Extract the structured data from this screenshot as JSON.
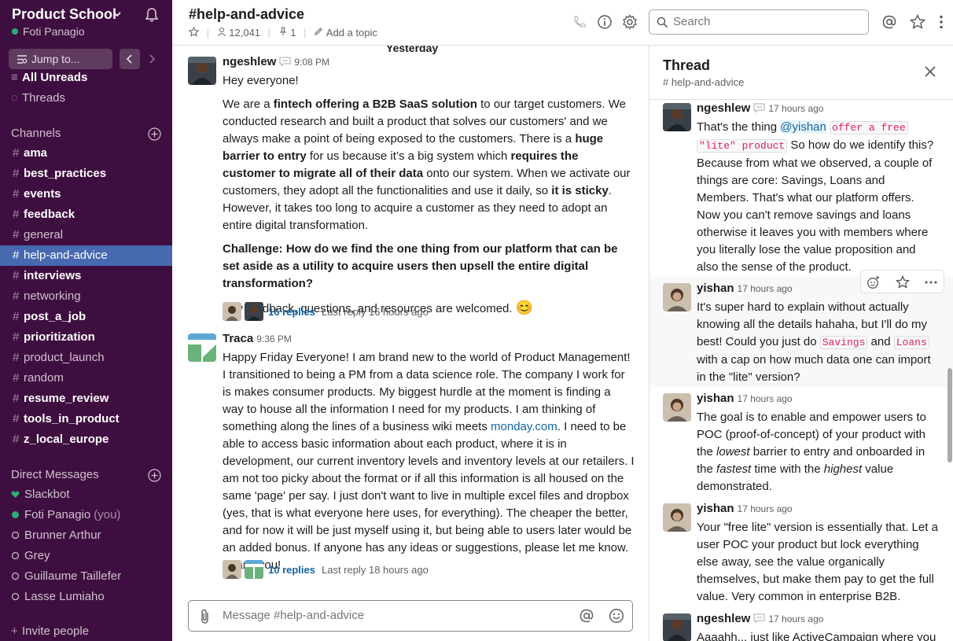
{
  "workspace": {
    "name": "Product School",
    "user": "Foti Panagio"
  },
  "sidebar": {
    "jump_label": "Jump to...",
    "top_items": [
      {
        "label": "All Unreads"
      },
      {
        "label": "Threads"
      }
    ],
    "channels_heading": "Channels",
    "channels": [
      {
        "name": "ama",
        "bold": true
      },
      {
        "name": "best_practices",
        "bold": true
      },
      {
        "name": "events",
        "bold": true
      },
      {
        "name": "feedback",
        "bold": true
      },
      {
        "name": "general",
        "bold": false
      },
      {
        "name": "help-and-advice",
        "bold": false,
        "active": true
      },
      {
        "name": "interviews",
        "bold": true
      },
      {
        "name": "networking",
        "bold": false
      },
      {
        "name": "post_a_job",
        "bold": true
      },
      {
        "name": "prioritization",
        "bold": true
      },
      {
        "name": "product_launch",
        "bold": false
      },
      {
        "name": "random",
        "bold": false
      },
      {
        "name": "resume_review",
        "bold": true
      },
      {
        "name": "tools_in_product",
        "bold": true
      },
      {
        "name": "z_local_europe",
        "bold": true
      }
    ],
    "dm_heading": "Direct Messages",
    "dms": [
      {
        "name": "Slackbot",
        "status": "heart"
      },
      {
        "name": "Foti Panagio",
        "status": "online",
        "suffix": "(you)"
      },
      {
        "name": "Brunner Arthur",
        "status": "away"
      },
      {
        "name": "Grey",
        "status": "away"
      },
      {
        "name": "Guillaume Taillefer",
        "status": "away"
      },
      {
        "name": "Lasse Lumiaho",
        "status": "away"
      }
    ],
    "invite_label": "Invite people"
  },
  "channel": {
    "name": "#help-and-advice",
    "members": "12,041",
    "pins": "1",
    "add_topic": "Add a topic",
    "day_divider": "Yesterday"
  },
  "search": {
    "placeholder": "Search"
  },
  "messages": [
    {
      "author": "ngeshlew",
      "time": "9:08 PM",
      "greeting": "Hey everyone!",
      "p1": [
        "We are a ",
        "fintech offering a B2B SaaS solution",
        " to our target customers. We conducted research and built a product that solves our customers' and we always make a point of being exposed to the customers. There is a ",
        "huge barrier to entry",
        " for us because it’s a big system which ",
        "requires the customer to migrate all of their data",
        " onto our system. When we activate our customers, they adopt all the functionalities and use it daily, so ",
        "it is sticky",
        ". However, it takes too long to acquire a customer as they need to adopt an entire digital transformation."
      ],
      "challenge": "Challenge: How do we find the one thing from our platform that can be set aside as a utility to acquire users then upsell the entire digital transformation?",
      "closing": "Any feedback, questions, and resources are welcomed.",
      "emoji": "😊",
      "replies": "16 replies",
      "last_reply": "Last reply 16 hours ago"
    },
    {
      "author": "Traca",
      "time": "9:36 PM",
      "text_before_link": "Happy Friday Everyone! I am brand new to the world of Product Management! I transitioned to being a PM from a data science role. The company I work for is makes consumer products. My biggest hurdle at the moment is finding a way to house all the information I need for my products. I am thinking of something along the lines of a business wiki meets ",
      "link": "monday.com",
      "text_after_link": ". I need to be able to access basic information about each product, where it is in development, our current inventory levels and inventory levels at our retailers. I am not too picky about the format or if all this information is all housed on the same 'page' per say. I just don't want to live in multiple excel files and dropbox (yes, that is what everyone here uses, for everything). The cheaper the better, and for now it will be just myself using it, but being able to users later would be an added bonus. If anyone has any ideas or suggestions, please let me know. Thank you!",
      "replies": "10 replies",
      "last_reply": "Last reply 18 hours ago"
    }
  ],
  "composer": {
    "placeholder": "Message #help-and-advice"
  },
  "thread": {
    "title": "Thread",
    "channel": "# help-and-advice",
    "messages": [
      {
        "author": "ngeshlew",
        "time": "17 hours ago",
        "t1": "That's the thing ",
        "mention": "@yishan",
        "code1": "offer a free",
        "code2": "\"lite\" product",
        "t2": " So how do we identify this? Because from what we observed, a couple of things are core: Savings, Loans and Members. That's what our platform offers. Now you can't remove savings and loans otherwise it leaves you with members where you literally lose the value proposition and also the sense of the product."
      },
      {
        "author": "yishan",
        "time": "17 hours ago",
        "t1": "It's super hard to explain without actually knowing all the details hahaha, but I'll do my best!  Could you just do ",
        "code1": "Savings",
        "t_and": " and ",
        "code2": "Loans",
        "t2": " with a cap on how much data one can import in the \"lite\" version?"
      },
      {
        "author": "yishan",
        "time": "17 hours ago",
        "a": "The goal is to enable and empower users to POC (proof-of-concept) of your product with the ",
        "em1": "lowest",
        "b": " barrier to entry and onboarded in the ",
        "em2": "fastest",
        "c": " time with the ",
        "em3": "highest",
        "d": " value demonstrated."
      },
      {
        "author": "yishan",
        "time": "17 hours ago",
        "text": "Your \"free lite\" version is essentially that.  Let a user POC your product but lock everything else away, see the value organically themselves, but make them pay to get the full value. Very common in enterprise B2B."
      },
      {
        "author": "ngeshlew",
        "time": "17 hours ago",
        "text": "Aaaahh... just like ActiveCampaign where you"
      }
    ]
  },
  "colors": {
    "sidebar_bg": "#3f0e40",
    "active_channel": "#4769b0",
    "link": "#1264a3",
    "online": "#2bac76",
    "code": "#e01e5a"
  }
}
